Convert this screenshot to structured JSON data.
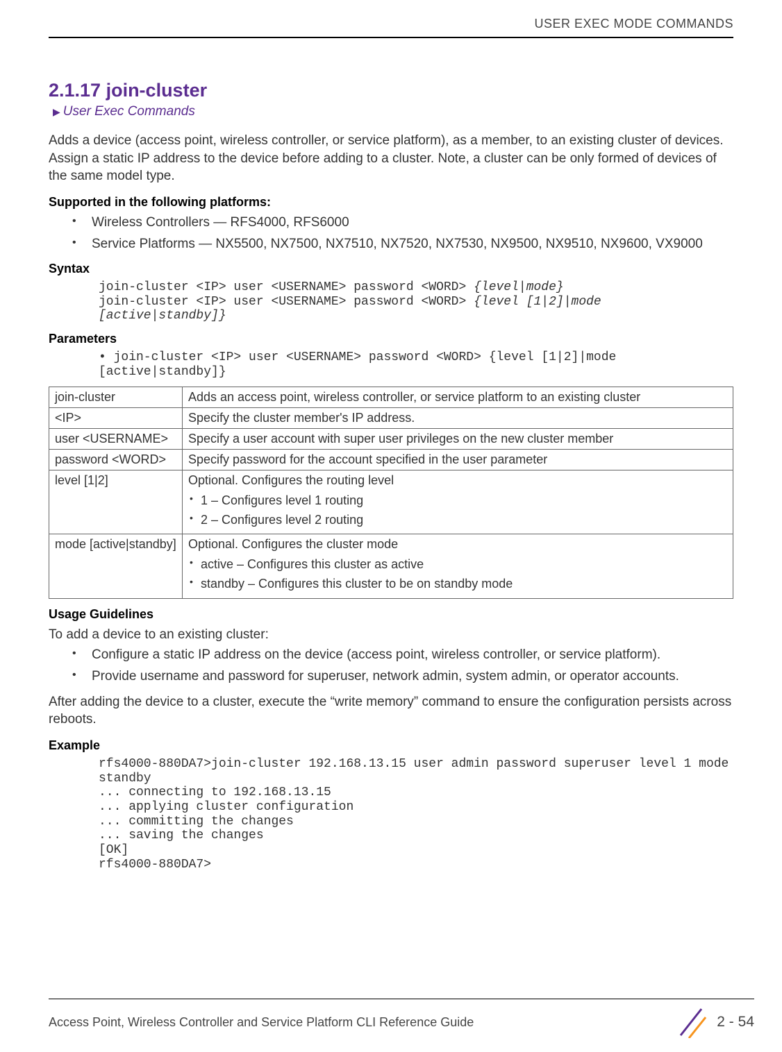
{
  "header": {
    "chapter_title": "USER EXEC MODE COMMANDS"
  },
  "section": {
    "number_title": "2.1.17 join-cluster",
    "breadcrumb": "User Exec Commands",
    "intro": "Adds a device (access point, wireless controller, or service platform), as a member, to an existing cluster of devices. Assign a static IP address to the device before adding to a cluster. Note, a cluster can be only formed of devices of the same model type."
  },
  "supported": {
    "heading": "Supported in the following platforms:",
    "items": [
      "Wireless Controllers — RFS4000, RFS6000",
      "Service Platforms — NX5500, NX7500, NX7510, NX7520, NX7530, NX9500, NX9510, NX9600, VX9000"
    ]
  },
  "syntax": {
    "heading": "Syntax",
    "line1_plain": "join-cluster <IP> user <USERNAME> password <WORD> ",
    "line1_ital": "{level|mode}",
    "line2_plain": "join-cluster <IP> user <USERNAME> password <WORD> ",
    "line2_ital": "{level [1|2]|mode [active|standby]}"
  },
  "parameters": {
    "heading": "Parameters",
    "code_bullet": "• join-cluster <IP> user <USERNAME> password <WORD> ",
    "code_ital": "{level [1|2]|mode [active|standby]}",
    "rows": [
      {
        "name": "join-cluster",
        "desc": "Adds an access point, wireless controller, or service platform to an existing cluster"
      },
      {
        "name": "<IP>",
        "desc": "Specify the cluster member's IP address."
      },
      {
        "name": "user <USERNAME>",
        "desc": "Specify a user account with super user privileges on the new cluster member"
      },
      {
        "name": "password <WORD>",
        "desc": "Specify password for the account specified in the user parameter"
      }
    ],
    "level_row": {
      "name": "level [1|2]",
      "lead": "Optional. Configures the routing level",
      "items": [
        "1 – Configures level 1 routing",
        "2 – Configures level 2 routing"
      ]
    },
    "mode_row": {
      "name": "mode [active|standby]",
      "lead": "Optional. Configures the cluster mode",
      "items": [
        "active – Configures this cluster as active",
        "standby – Configures this cluster to be on standby mode"
      ]
    }
  },
  "usage": {
    "heading": "Usage Guidelines",
    "lead": "To add a device to an existing cluster:",
    "items": [
      "Configure a static IP address on the device (access point, wireless controller, or service platform).",
      "Provide username and password for superuser, network admin, system admin, or operator accounts."
    ],
    "after": "After adding the device to a cluster, execute the “write memory” command to ensure the configuration persists across reboots."
  },
  "example": {
    "heading": "Example",
    "text": "rfs4000-880DA7>join-cluster 192.168.13.15 user admin password superuser level 1 mode standby\n... connecting to 192.168.13.15\n... applying cluster configuration\n... committing the changes\n... saving the changes\n[OK]\nrfs4000-880DA7>"
  },
  "footer": {
    "doc_title": "Access Point, Wireless Controller and Service Platform CLI Reference Guide",
    "page_number": "2 - 54"
  }
}
